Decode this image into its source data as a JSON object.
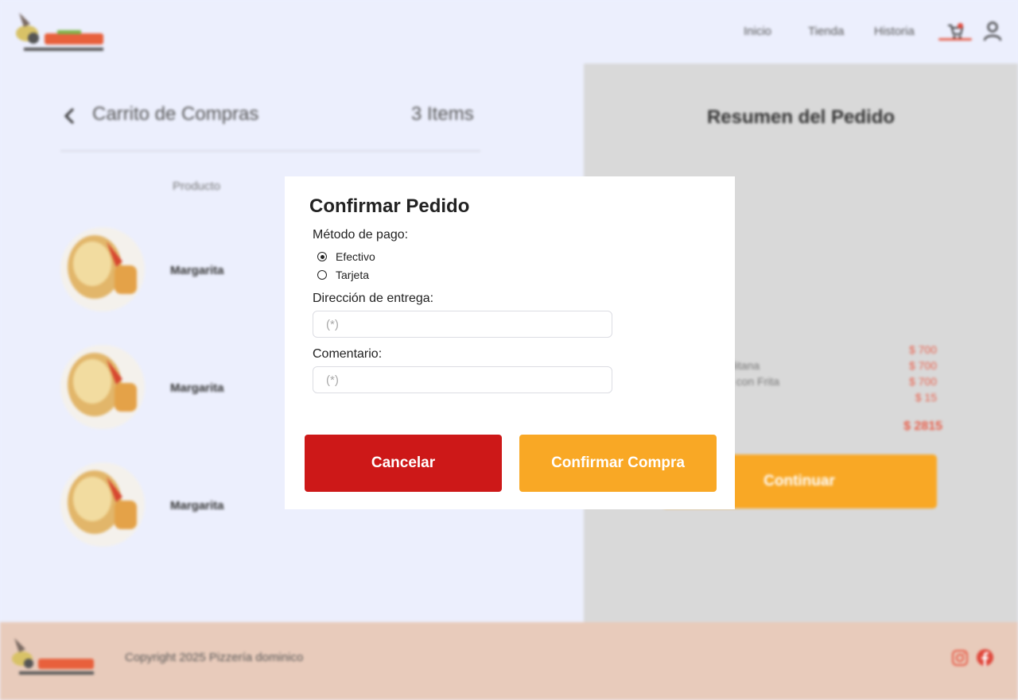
{
  "header": {
    "nav": [
      {
        "label": "Inicio"
      },
      {
        "label": "Tienda"
      },
      {
        "label": "Historia"
      }
    ],
    "icons": [
      "cart-icon",
      "user-icon"
    ]
  },
  "cart": {
    "title": "Carrito de Compras",
    "item_count": "3 Items",
    "column_product": "Producto",
    "items": [
      {
        "name": "Margarita"
      },
      {
        "name": "Margarita"
      },
      {
        "name": "Margarita"
      }
    ]
  },
  "summary": {
    "title": "Resumen del Pedido",
    "lines": [
      {
        "name": "",
        "price": "$ 700"
      },
      {
        "name": "...litana",
        "price": "$ 700"
      },
      {
        "name": "... con Frita",
        "price": "$ 700"
      },
      {
        "name": "",
        "price": "$ 15"
      }
    ],
    "total": "$ 2815",
    "continue_label": "Continuar"
  },
  "footer": {
    "copyright": "Copyright 2025 Pizzería dominico",
    "icons": [
      "instagram-icon",
      "facebook-icon"
    ]
  },
  "modal": {
    "title": "Confirmar Pedido",
    "payment_label": "Método de pago:",
    "payment_options": [
      {
        "label": "Efectivo",
        "selected": true
      },
      {
        "label": "Tarjeta",
        "selected": false
      }
    ],
    "address_label": "Dirección de entrega:",
    "address_placeholder": "(*)",
    "address_value": "",
    "comment_label": "Comentario:",
    "comment_placeholder": "(*)",
    "comment_value": "",
    "cancel_label": "Cancelar",
    "confirm_label": "Confirmar Compra"
  },
  "colors": {
    "accent_orange": "#f9a825",
    "cancel_red": "#cd1818",
    "price_red": "#e8604c",
    "page_bg": "#eceffd",
    "summary_bg": "#d9d9d9",
    "footer_bg": "#e8cbbb"
  }
}
